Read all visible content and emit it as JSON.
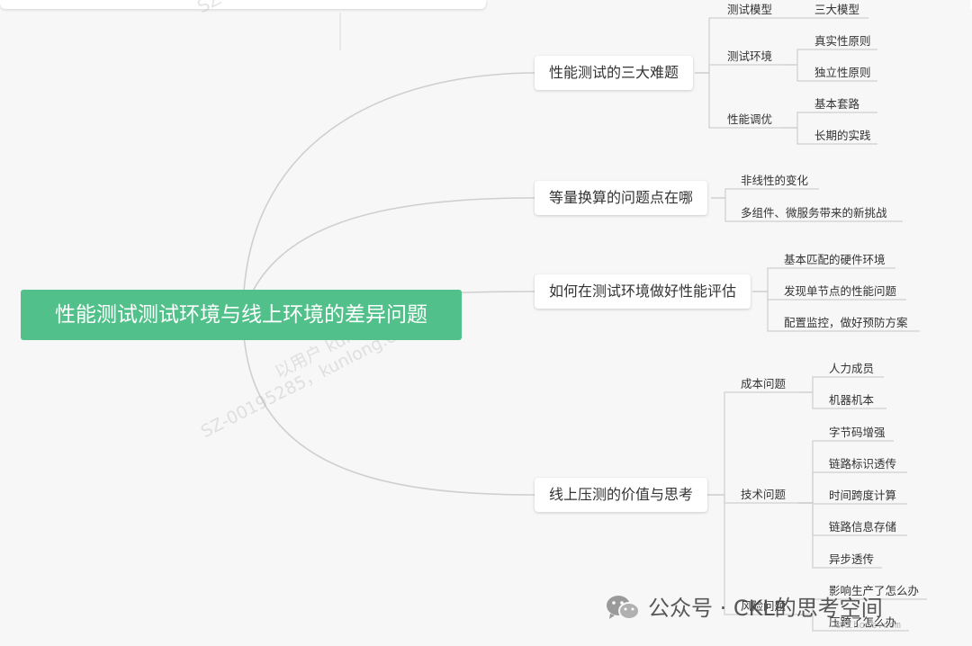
{
  "root": {
    "label": "性能测试测试环境与线上环境的差异问题"
  },
  "branches": [
    {
      "label": "性能测试的三大难题",
      "children": [
        {
          "label": "测试模型",
          "leaves": [
            "三大模型"
          ]
        },
        {
          "label": "测试环境",
          "leaves": [
            "真实性原则",
            "独立性原则"
          ]
        },
        {
          "label": "性能调优",
          "leaves": [
            "基本套路",
            "长期的实践"
          ]
        }
      ]
    },
    {
      "label": "等量换算的问题点在哪",
      "leaves": [
        "非线性的变化",
        "多组件、微服务带来的新挑战"
      ]
    },
    {
      "label": "如何在测试环境做好性能评估",
      "leaves": [
        "基本匹配的硬件环境",
        "发现单节点的性能问题",
        "配置监控，做好预防方案"
      ]
    },
    {
      "label": "线上压测的价值与思考",
      "children": [
        {
          "label": "成本问题",
          "leaves": [
            "人力成员",
            "机器机本"
          ]
        },
        {
          "label": "技术问题",
          "leaves": [
            "字节码增强",
            "链路标识透传",
            "时间跨度计算",
            "链路信息存储",
            "异步透传"
          ]
        },
        {
          "label": "风险问题",
          "leaves": [
            "影响生产了怎么办",
            "压跨了怎么办"
          ]
        }
      ]
    }
  ],
  "watermark": {
    "line1": "以用户 kunlong.chen",
    "line2": "SZ-00195285，kunlong.chen",
    "top": "SZ"
  },
  "footer": {
    "label": "公众号 · CKL的思考空间",
    "url": "cklhome.com"
  },
  "colors": {
    "root_bg": "#52c08a",
    "connector": "#cfcfcf",
    "underline": "#d6d6d6"
  }
}
